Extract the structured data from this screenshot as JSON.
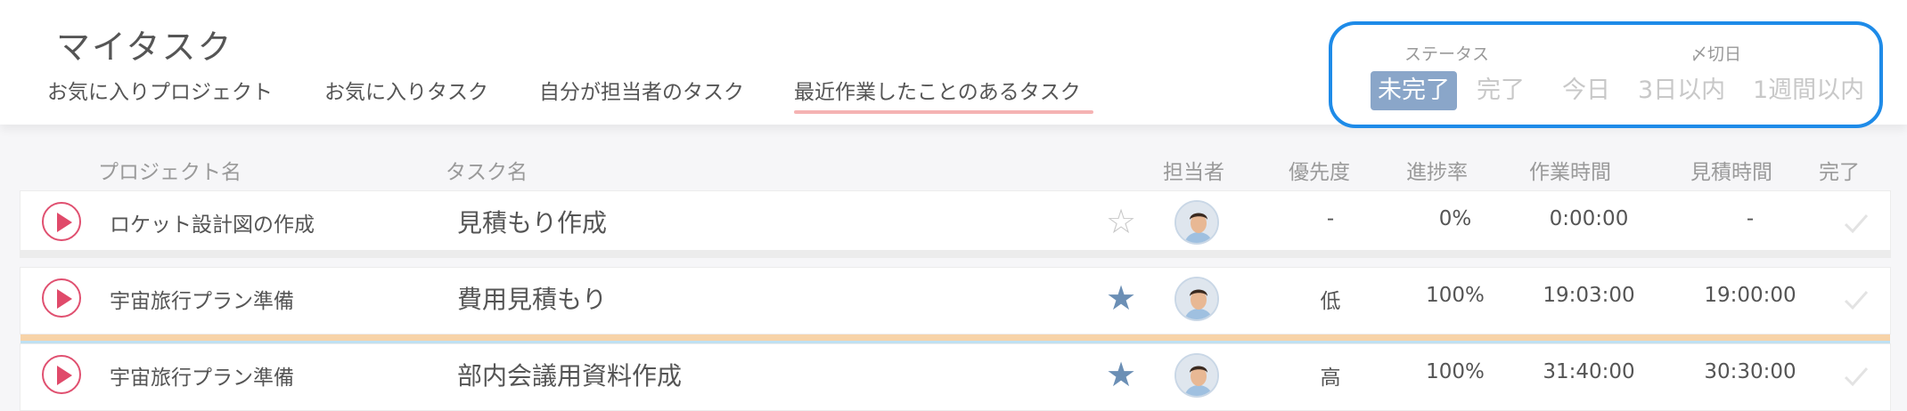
{
  "header": {
    "title": "マイタスク",
    "tabs": [
      {
        "label": "お気に入りプロジェクト"
      },
      {
        "label": "お気に入りタスク"
      },
      {
        "label": "自分が担当者のタスク"
      },
      {
        "label": "最近作業したことのあるタスク",
        "active": true
      }
    ]
  },
  "filter": {
    "status_label": "ステータス",
    "due_label": "〆切日",
    "options": [
      "未完了",
      "完了",
      "今日",
      "3日以内",
      "1週間以内"
    ],
    "active_option": "未完了"
  },
  "columns": {
    "project": "プロジェクト名",
    "task": "タスク名",
    "assignee": "担当者",
    "priority": "優先度",
    "progress": "進捗率",
    "work_time": "作業時間",
    "estimate_time": "見積時間",
    "done": "完了"
  },
  "rows": [
    {
      "project": "ロケット設計図の作成",
      "task": "見積もり作成",
      "starred": false,
      "priority": "-",
      "progress": "0%",
      "work_time": "0:00:00",
      "estimate_time": "-"
    },
    {
      "project": "宇宙旅行プラン準備",
      "task": "費用見積もり",
      "starred": true,
      "priority": "低",
      "progress": "100%",
      "work_time": "19:03:00",
      "estimate_time": "19:00:00"
    },
    {
      "project": "宇宙旅行プラン準備",
      "task": "部内会議用資料作成",
      "starred": true,
      "priority": "高",
      "progress": "100%",
      "work_time": "31:40:00",
      "estimate_time": "30:30:00"
    }
  ],
  "colors": {
    "accent_blue": "#1e8be8",
    "tab_underline": "#f5b3b3",
    "play": "#e04a6a",
    "star_on": "#6b8fb5",
    "active_filter": "#8aa6c9",
    "stripe_orange": "#f7d3a8",
    "stripe_blue": "#bfe0f2",
    "stripe_pink": "#f2b5cc"
  }
}
